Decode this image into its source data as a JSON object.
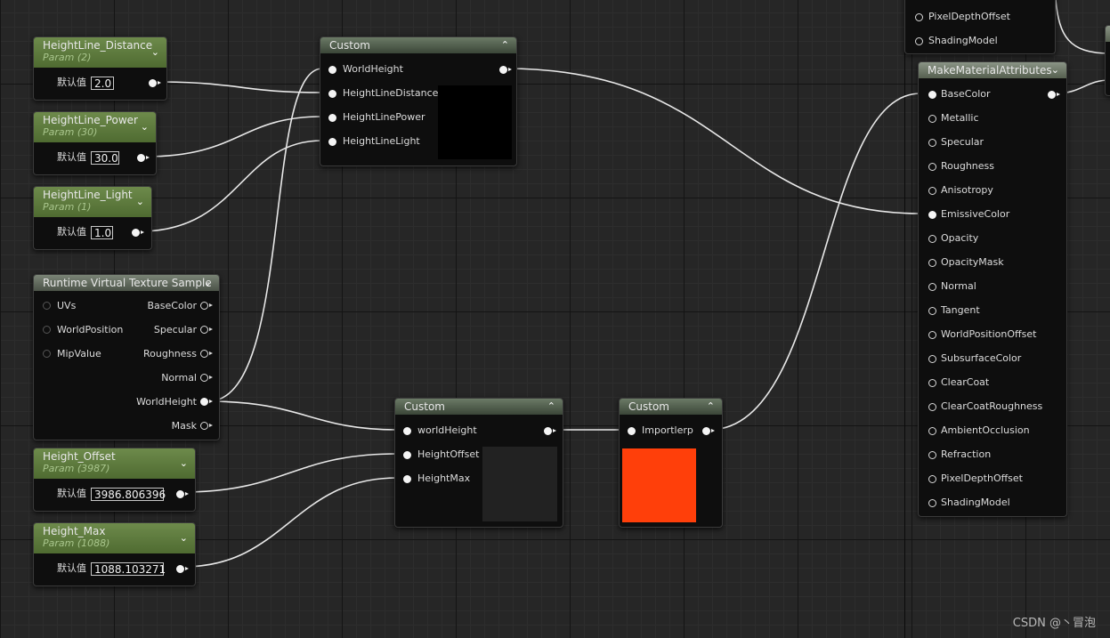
{
  "params": {
    "distance": {
      "title": "HeightLine_Distance",
      "sub": "Param (2)",
      "default_label": "默认值",
      "value": "2.0"
    },
    "power": {
      "title": "HeightLine_Power",
      "sub": "Param (30)",
      "default_label": "默认值",
      "value": "30.0"
    },
    "light": {
      "title": "HeightLine_Light",
      "sub": "Param (1)",
      "default_label": "默认值",
      "value": "1.0"
    },
    "offset": {
      "title": "Height_Offset",
      "sub": "Param (3987)",
      "default_label": "默认值",
      "value": "3986.806396"
    },
    "max": {
      "title": "Height_Max",
      "sub": "Param (1088)",
      "default_label": "默认值",
      "value": "1088.103271"
    }
  },
  "custom1": {
    "title": "Custom",
    "inputs": [
      "WorldHeight",
      "HeightLineDistance",
      "HeightLinePower",
      "HeightLineLight"
    ]
  },
  "custom2": {
    "title": "Custom",
    "inputs": [
      "worldHeight",
      "HeightOffset",
      "HeightMax"
    ]
  },
  "custom3": {
    "title": "Custom",
    "inputs": [
      "Importlerp"
    ],
    "preview_color": "#ff3f0a"
  },
  "rvt": {
    "title": "Runtime Virtual Texture Sample",
    "inputs": [
      "UVs",
      "WorldPosition",
      "MipValue"
    ],
    "outputs": [
      "BaseColor",
      "Specular",
      "Roughness",
      "Normal",
      "WorldHeight",
      "Mask"
    ]
  },
  "partial": {
    "items": [
      "PixelDepthOffset",
      "ShadingModel"
    ]
  },
  "mma": {
    "title": "MakeMaterialAttributes",
    "inputs": [
      "BaseColor",
      "Metallic",
      "Specular",
      "Roughness",
      "Anisotropy",
      "EmissiveColor",
      "Opacity",
      "OpacityMask",
      "Normal",
      "Tangent",
      "WorldPositionOffset",
      "SubsurfaceColor",
      "ClearCoat",
      "ClearCoatRoughness",
      "AmbientOcclusion",
      "Refraction",
      "PixelDepthOffset",
      "ShadingModel"
    ]
  },
  "watermark": "CSDN @丶冒泡"
}
